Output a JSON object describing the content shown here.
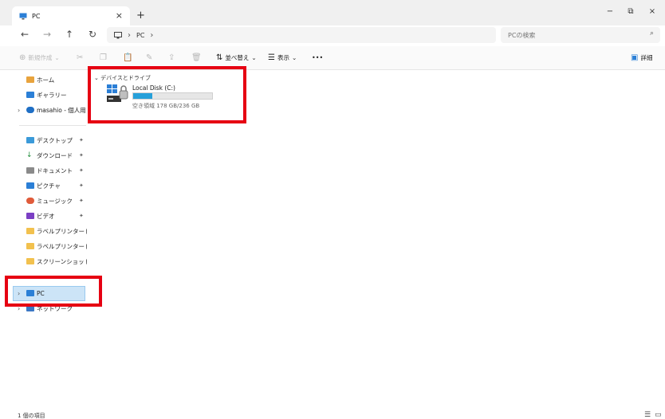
{
  "tab": {
    "title": "PC",
    "close": "×",
    "new": "+"
  },
  "window": {
    "minimize": "−",
    "restore": "⧉",
    "close": "×"
  },
  "nav": {
    "back": "←",
    "forward": "→",
    "up": "↑",
    "refresh": "↻"
  },
  "address": {
    "root": "PC",
    "sep1": "›",
    "sep2": "›"
  },
  "search": {
    "placeholder": "PCの検索",
    "icon": "⌕"
  },
  "toolbar": {
    "new_label": "新規作成",
    "sort_label": "並べ替え",
    "view_label": "表示",
    "more": "•••",
    "details_label": "詳細"
  },
  "sidebar": {
    "home": "ホーム",
    "gallery": "ギャラリー",
    "onedrive": "masahio - 個人用",
    "desktop": "デスクトップ",
    "downloads": "ダウンロード",
    "documents": "ドキュメント",
    "pictures": "ピクチャ",
    "music": "ミュージック",
    "videos": "ビデオ",
    "folder1": "ラベルプリンタードライバ",
    "folder2": "ラベルプリンタードライバ",
    "screenshots": "スクリーンショット",
    "pc": "PC",
    "network": "ネットワーク",
    "pin": "📌",
    "chev": "›"
  },
  "content": {
    "group_header": "デバイスとドライブ",
    "drive_name": "Local Disk (C:)",
    "drive_space": "空き領域 178 GB/236 GB",
    "drive_used_fraction": 0.246
  },
  "status": {
    "count": "1 個の項目"
  },
  "colors": {
    "highlight": "#e60012",
    "selection": "#cce4f7",
    "accent": "#26a0da"
  }
}
